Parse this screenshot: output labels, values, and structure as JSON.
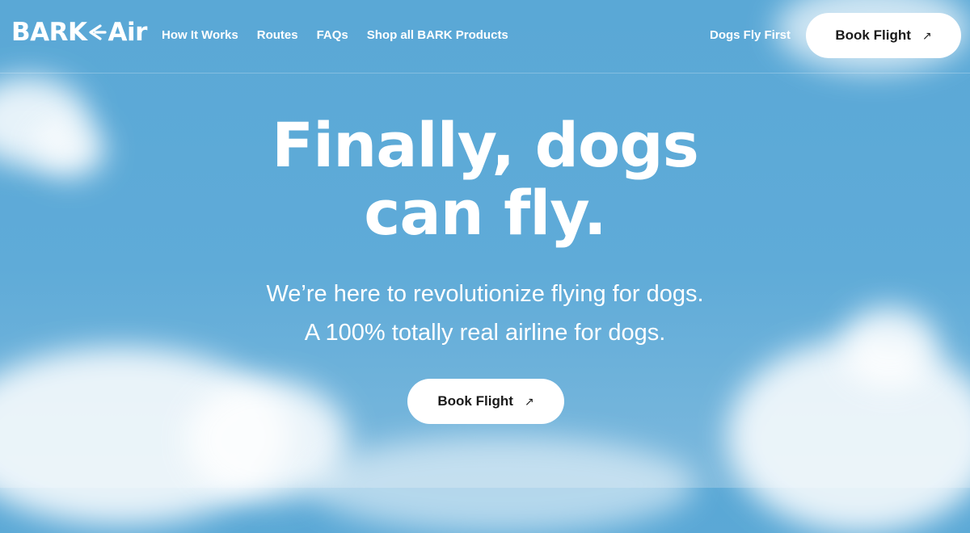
{
  "brand": {
    "logo_text_left": "BARK",
    "logo_text_right": "Air"
  },
  "nav": {
    "items": [
      {
        "label": "How It Works"
      },
      {
        "label": "Routes"
      },
      {
        "label": "FAQs"
      },
      {
        "label": "Shop all BARK Products"
      }
    ],
    "right_link": "Dogs Fly First",
    "cta_label": "Book Flight"
  },
  "hero": {
    "title_line1": "Finally, dogs",
    "title_line2": "can fly.",
    "subtitle_line1": "We’re here to revolutionize flying for dogs.",
    "subtitle_line2": "A 100% totally real airline for dogs.",
    "cta_label": "Book Flight"
  },
  "colors": {
    "sky": "#5fabd8",
    "button_bg": "#ffffff",
    "text": "#ffffff"
  },
  "icons": {
    "cta_arrow": "arrow-up-right-icon"
  }
}
